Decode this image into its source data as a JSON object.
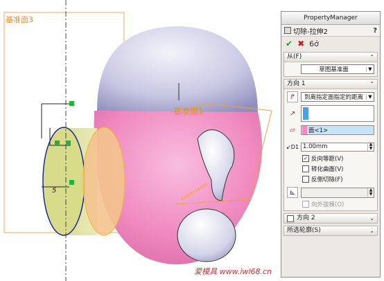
{
  "viewport": {
    "plane3_label": "基准面3",
    "plane1_label": "基准面1",
    "dimension_label": "5",
    "watermark": "爱模具 www.iwl68.cn"
  },
  "property_manager": {
    "title": "PropertyManager",
    "feature_name": "切除-拉伸2",
    "help_icon": "?",
    "from_group": {
      "label": "从(F)",
      "start_condition": "草图基准面"
    },
    "direction1_group": {
      "label": "方向 1",
      "end_condition": "到离指定面指定的距离",
      "face_selection": "面<1>",
      "offset_value": "1.00mm",
      "checkboxes": [
        {
          "label": "反向等距(V)",
          "checked": true,
          "enabled": true
        },
        {
          "label": "转化曲面(V)",
          "checked": false,
          "enabled": true
        },
        {
          "label": "反侧切除(F)",
          "checked": false,
          "enabled": true
        }
      ],
      "draft_outward_label": "向外拔模(O)"
    },
    "direction2_group": {
      "label": "方向 2"
    },
    "contours_group": {
      "label": "所选轮廓(S)"
    }
  },
  "colors": {
    "accent_green": "#1e9e2a",
    "cancel_red": "#c21c1c",
    "plane_orange": "#e8902a",
    "face_pink": "#f08ac0",
    "direction_blue": "#4aa3e0"
  }
}
